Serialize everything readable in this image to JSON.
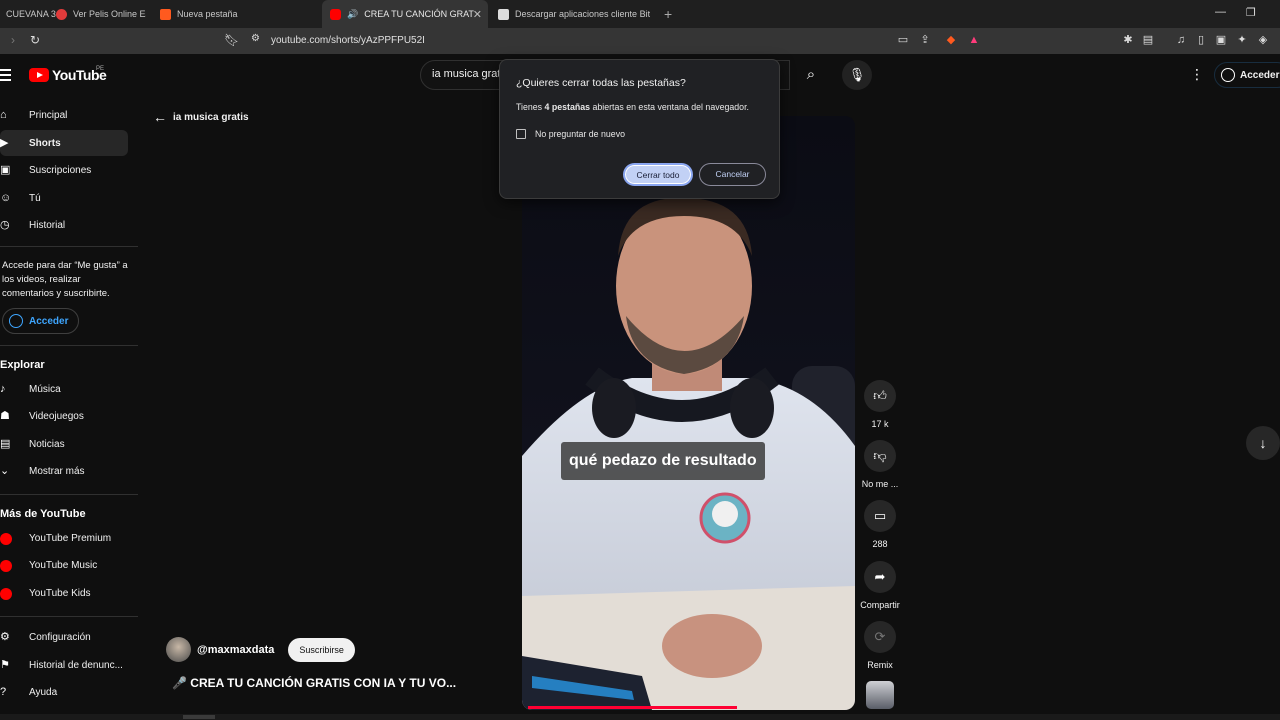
{
  "browser": {
    "tabs": [
      {
        "label": "CUEVANA 3",
        "favicon_color": "#2b2b2b"
      },
      {
        "label": "Ver Pelis Online Estr",
        "favicon_color": "#e03b3b"
      },
      {
        "label": "Nueva pestaña",
        "favicon_color": "#ff5a1f"
      },
      {
        "label": "CREA TU CANCIÓN GRAT",
        "favicon_color": "#ff0000"
      },
      {
        "label": "Descargar aplicaciones cliente BitTorr",
        "favicon_color": "#dddddd"
      }
    ],
    "new_tab": "+",
    "url": "youtube.com/shorts/yAzPPFPU52I"
  },
  "masthead": {
    "logo_text": "YouTube",
    "country_code": "PE",
    "search_query": "ia musica grat",
    "signin_label": "Acceder"
  },
  "sidebar": {
    "items": [
      {
        "label": "Principal",
        "icon": "home-icon"
      },
      {
        "label": "Shorts",
        "icon": "shorts-icon"
      },
      {
        "label": "Suscripciones",
        "icon": "subscriptions-icon"
      },
      {
        "label": "Tú",
        "icon": "user-icon"
      },
      {
        "label": "Historial",
        "icon": "history-icon"
      }
    ],
    "signin_note": "Accede para dar “Me gusta” a los videos, realizar comentarios y suscribirte.",
    "signin_label": "Acceder",
    "explore_title": "Explorar",
    "explore_items": [
      {
        "label": "Música",
        "icon": "music-icon"
      },
      {
        "label": "Videojuegos",
        "icon": "gaming-icon"
      },
      {
        "label": "Noticias",
        "icon": "news-icon"
      },
      {
        "label": "Mostrar más",
        "icon": "chevron-down-icon"
      }
    ],
    "more_title": "Más de YouTube",
    "more_items": [
      {
        "label": "YouTube Premium"
      },
      {
        "label": "YouTube Music"
      },
      {
        "label": "YouTube Kids"
      }
    ],
    "settings_items": [
      {
        "label": "Configuración",
        "icon": "gear-icon"
      },
      {
        "label": "Historial de denunc...",
        "icon": "flag-icon"
      },
      {
        "label": "Ayuda",
        "icon": "help-icon"
      }
    ]
  },
  "main": {
    "back_label": "ia musica gratis",
    "caption": "qué pedazo de resultado",
    "progress_fraction": 0.64,
    "channel_handle": "@maxmaxdata",
    "subscribe_label": "Suscribirse",
    "short_title": "🎤 CREA TU CANCIÓN GRATIS CON IA Y TU VO...",
    "actions": {
      "like_count": "17 k",
      "dislike_label": "No me ...",
      "comments_count": "288",
      "share_label": "Compartir",
      "remix_label": "Remix"
    }
  },
  "dialog": {
    "title": "¿Quieres cerrar todas las pestañas?",
    "body_pre": "Tienes ",
    "body_bold": "4 pestañas",
    "body_post": " abiertas en esta ventana del navegador.",
    "checkbox_label": "No preguntar de nuevo",
    "primary_label": "Cerrar todo",
    "secondary_label": "Cancelar"
  },
  "colors": {
    "youtube_red": "#ff0000",
    "link_blue": "#3ea6ff",
    "dialog_accent": "#c2d1f5"
  }
}
